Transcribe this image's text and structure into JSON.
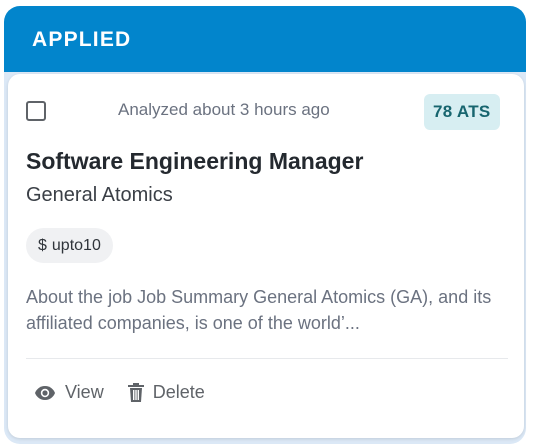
{
  "column": {
    "title": "APPLIED",
    "color": "#0285cc"
  },
  "card": {
    "analyzed_text": "Analyzed about 3 hours ago",
    "ats_badge": "78 ATS",
    "title": "Software Engineering Manager",
    "company": "General Atomics",
    "salary": {
      "icon": "dollar-icon",
      "currency_symbol": "$",
      "label": "upto10"
    },
    "description": "About the job Job Summary General Atomics (GA), and its affiliated companies, is one of the world’...",
    "actions": [
      {
        "label": "View",
        "icon": "eye-icon"
      },
      {
        "label": "Delete",
        "icon": "trash-icon"
      }
    ]
  }
}
